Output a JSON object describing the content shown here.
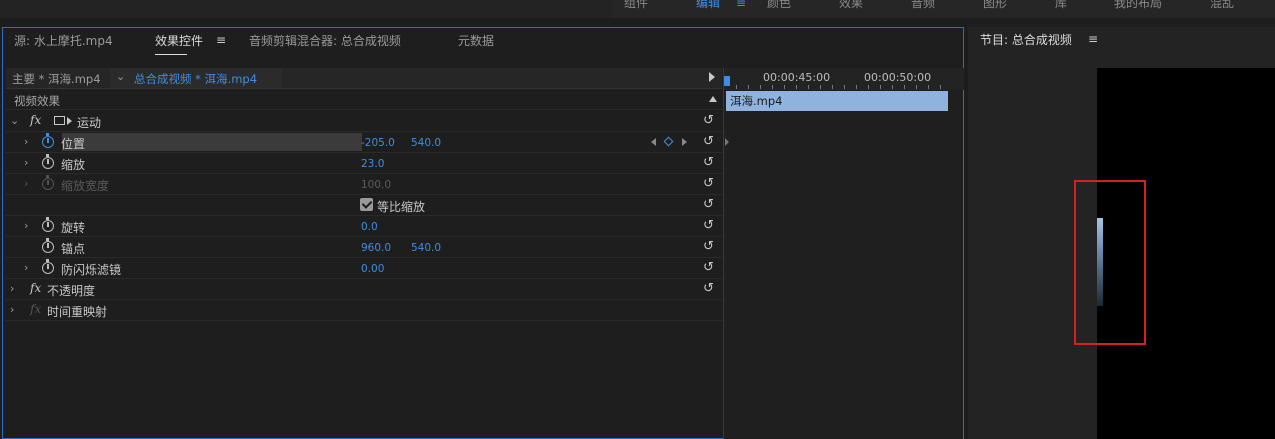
{
  "workspace_tabs": [
    "组件",
    "编辑",
    "颜色",
    "效果",
    "音频",
    "图形",
    "库",
    "我的布局",
    "混乱"
  ],
  "workspace_active": "编辑",
  "panel_tabs": {
    "source": "源: 水上摩托.mp4",
    "effect_controls": "效果控件",
    "audio_mixer": "音频剪辑混合器: 总合成视频",
    "metadata": "元数据"
  },
  "clip_header": {
    "master": "主要 * 洱海.mp4",
    "sequence": "总合成视频 * 洱海.mp4"
  },
  "section_label": "视频效果",
  "effects": {
    "motion_label": "运动",
    "position_label": "位置",
    "position_x": "-205.0",
    "position_y": "540.0",
    "scale_label": "缩放",
    "scale_value": "23.0",
    "scale_width_label": "缩放宽度",
    "scale_width_value": "100.0",
    "uniform_scale_label": "等比缩放",
    "uniform_scale_checked": true,
    "rotation_label": "旋转",
    "rotation_value": "0.0",
    "anchor_label": "锚点",
    "anchor_x": "960.0",
    "anchor_y": "540.0",
    "flicker_label": "防闪烁滤镜",
    "flicker_value": "0.00",
    "opacity_label": "不透明度",
    "time_remap_label": "时间重映射"
  },
  "mini_timeline": {
    "time_1": "00:00:45:00",
    "time_2": "00:00:50:00",
    "clip_name": "洱海.mp4"
  },
  "program_monitor": {
    "title": "节目: 总合成视频"
  },
  "colors": {
    "accent_blue": "#3f8de3",
    "selection_red": "#d81e1e",
    "clip_blue": "#8fb3de"
  }
}
